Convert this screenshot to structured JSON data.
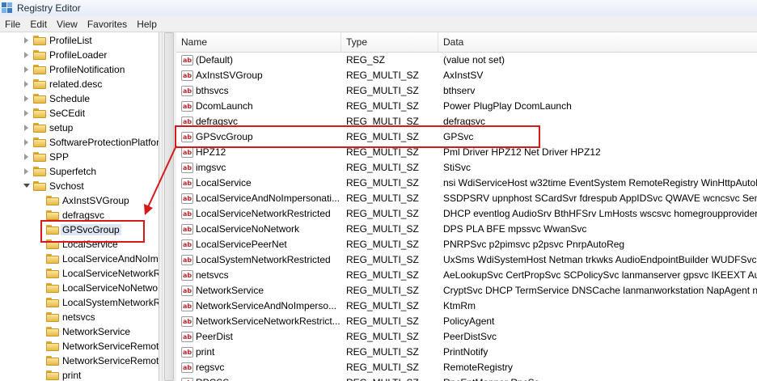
{
  "window": {
    "title": "Registry Editor"
  },
  "menu": [
    "File",
    "Edit",
    "View",
    "Favorites",
    "Help"
  ],
  "tree": {
    "items": [
      {
        "label": "ProfileList",
        "state": "collapsed",
        "level": 0
      },
      {
        "label": "ProfileLoader",
        "state": "collapsed",
        "level": 0
      },
      {
        "label": "ProfileNotification",
        "state": "collapsed",
        "level": 0
      },
      {
        "label": "related.desc",
        "state": "collapsed",
        "level": 0
      },
      {
        "label": "Schedule",
        "state": "collapsed",
        "level": 0
      },
      {
        "label": "SeCEdit",
        "state": "collapsed",
        "level": 0
      },
      {
        "label": "setup",
        "state": "collapsed",
        "level": 0
      },
      {
        "label": "SoftwareProtectionPlatfor",
        "state": "collapsed",
        "level": 0
      },
      {
        "label": "SPP",
        "state": "collapsed",
        "level": 0
      },
      {
        "label": "Superfetch",
        "state": "collapsed",
        "level": 0
      },
      {
        "label": "Svchost",
        "state": "expanded",
        "level": 0
      },
      {
        "label": "AxInstSVGroup",
        "state": "leaf",
        "level": 1
      },
      {
        "label": "defragsvc",
        "state": "leaf",
        "level": 1
      },
      {
        "label": "GPSvcGroup",
        "state": "leaf",
        "level": 1,
        "selected": true
      },
      {
        "label": "LocalService",
        "state": "leaf",
        "level": 1
      },
      {
        "label": "LocalServiceAndNoIm",
        "state": "leaf",
        "level": 1
      },
      {
        "label": "LocalServiceNetworkR",
        "state": "leaf",
        "level": 1
      },
      {
        "label": "LocalServiceNoNetwo",
        "state": "leaf",
        "level": 1
      },
      {
        "label": "LocalSystemNetworkR",
        "state": "leaf",
        "level": 1
      },
      {
        "label": "netsvcs",
        "state": "leaf",
        "level": 1
      },
      {
        "label": "NetworkService",
        "state": "leaf",
        "level": 1
      },
      {
        "label": "NetworkServiceRemot",
        "state": "leaf",
        "level": 1
      },
      {
        "label": "NetworkServiceRemot",
        "state": "leaf",
        "level": 1
      },
      {
        "label": "print",
        "state": "leaf",
        "level": 1
      }
    ]
  },
  "list": {
    "columns": [
      "Name",
      "Type",
      "Data"
    ],
    "rows": [
      {
        "name": "(Default)",
        "type": "REG_SZ",
        "data": "(value not set)"
      },
      {
        "name": "AxInstSVGroup",
        "type": "REG_MULTI_SZ",
        "data": "AxInstSV"
      },
      {
        "name": "bthsvcs",
        "type": "REG_MULTI_SZ",
        "data": "bthserv"
      },
      {
        "name": "DcomLaunch",
        "type": "REG_MULTI_SZ",
        "data": "Power PlugPlay DcomLaunch"
      },
      {
        "name": "defragsvc",
        "type": "REG_MULTI_SZ",
        "data": "defragsvc"
      },
      {
        "name": "GPSvcGroup",
        "type": "REG_MULTI_SZ",
        "data": "GPSvc"
      },
      {
        "name": "HPZ12",
        "type": "REG_MULTI_SZ",
        "data": "Pml Driver HPZ12 Net Driver HPZ12"
      },
      {
        "name": "imgsvc",
        "type": "REG_MULTI_SZ",
        "data": "StiSvc"
      },
      {
        "name": "LocalService",
        "type": "REG_MULTI_SZ",
        "data": "nsi WdiServiceHost w32time EventSystem RemoteRegistry WinHttpAutoPr"
      },
      {
        "name": "LocalServiceAndNoImpersonati...",
        "type": "REG_MULTI_SZ",
        "data": "SSDPSRV upnphost SCardSvr fdrespub AppIDSvc QWAVE wcncsvc SensrSv"
      },
      {
        "name": "LocalServiceNetworkRestricted",
        "type": "REG_MULTI_SZ",
        "data": "DHCP eventlog AudioSrv BthHFSrv LmHosts wscsvc homegroupprovider T"
      },
      {
        "name": "LocalServiceNoNetwork",
        "type": "REG_MULTI_SZ",
        "data": "DPS PLA BFE mpssvc WwanSvc"
      },
      {
        "name": "LocalServicePeerNet",
        "type": "REG_MULTI_SZ",
        "data": "PNRPSvc p2pimsvc p2psvc PnrpAutoReg"
      },
      {
        "name": "LocalSystemNetworkRestricted",
        "type": "REG_MULTI_SZ",
        "data": "UxSms WdiSystemHost Netman trkwks AudioEndpointBuilder WUDFSvc IP"
      },
      {
        "name": "netsvcs",
        "type": "REG_MULTI_SZ",
        "data": "AeLookupSvc CertPropSvc SCPolicySvc lanmanserver gpsvc IKEEXT Audio"
      },
      {
        "name": "NetworkService",
        "type": "REG_MULTI_SZ",
        "data": "CryptSvc DHCP TermService DNSCache lanmanworkstation NapAgent nla"
      },
      {
        "name": "NetworkServiceAndNoImperso...",
        "type": "REG_MULTI_SZ",
        "data": "KtmRm"
      },
      {
        "name": "NetworkServiceNetworkRestrict...",
        "type": "REG_MULTI_SZ",
        "data": "PolicyAgent"
      },
      {
        "name": "PeerDist",
        "type": "REG_MULTI_SZ",
        "data": "PeerDistSvc"
      },
      {
        "name": "print",
        "type": "REG_MULTI_SZ",
        "data": "PrintNotify"
      },
      {
        "name": "regsvc",
        "type": "REG_MULTI_SZ",
        "data": "RemoteRegistry"
      },
      {
        "name": "RPCSS",
        "type": "REG_MULTI_SZ",
        "data": "RpcEptMapper RpcSs"
      }
    ]
  },
  "value_icon_text": "ab",
  "annotation": {
    "color": "#d61a1a"
  }
}
